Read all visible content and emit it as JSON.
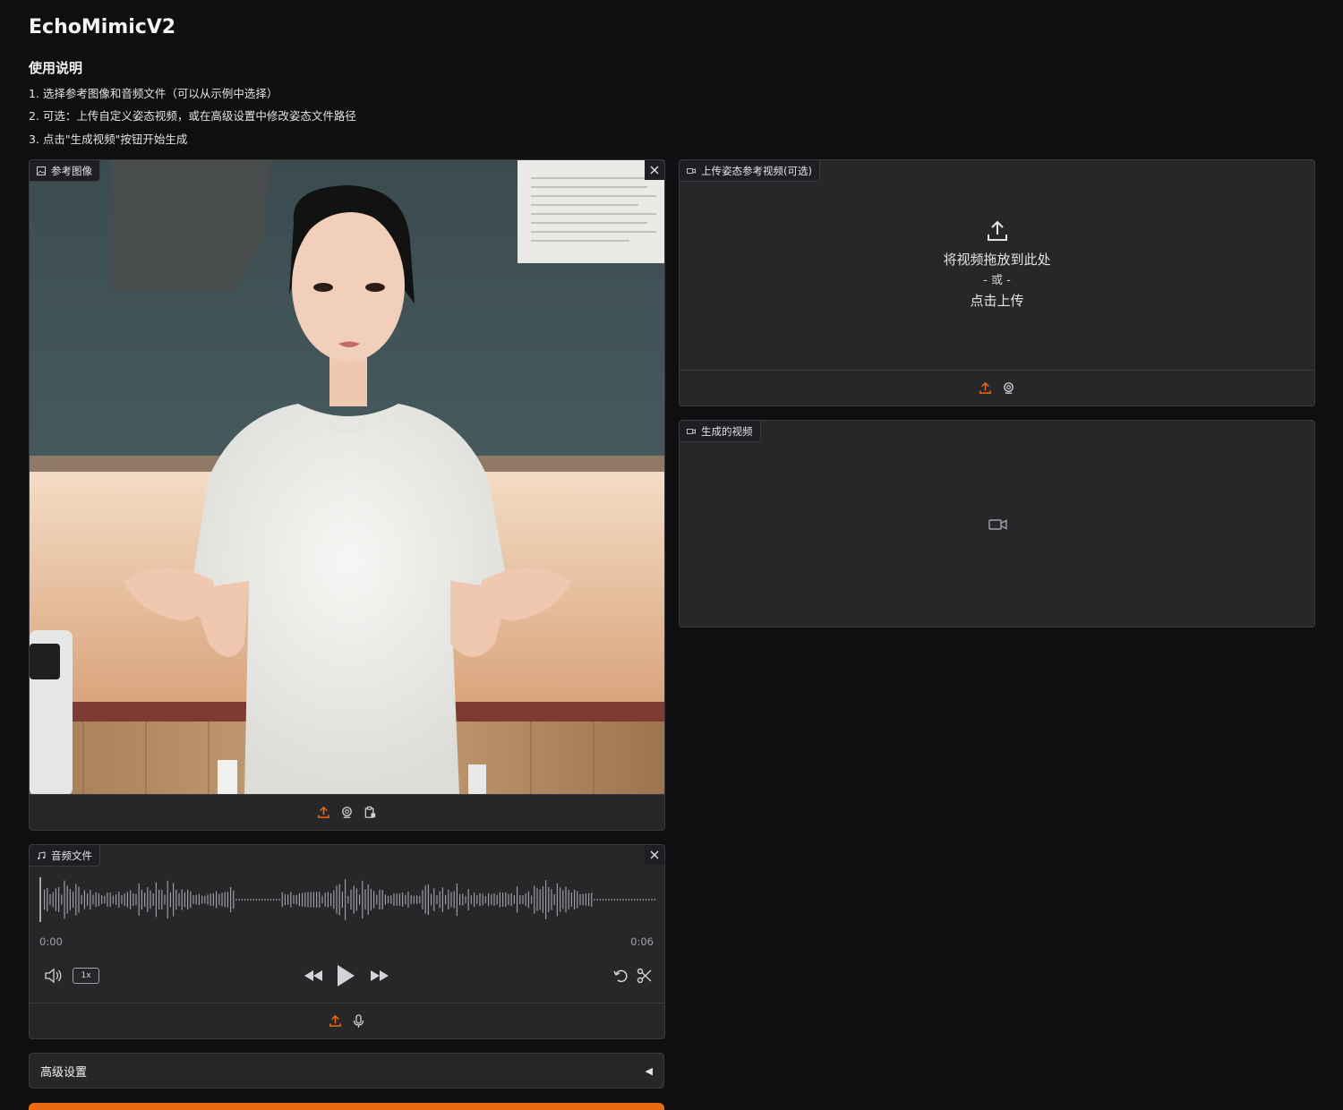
{
  "app": {
    "title": "EchoMimicV2"
  },
  "instructions": {
    "heading": "使用说明",
    "items": [
      "1. 选择参考图像和音频文件（可以从示例中选择）",
      "2. 可选：上传自定义姿态视频，或在高级设置中修改姿态文件路径",
      "3. 点击\"生成视频\"按钮开始生成"
    ]
  },
  "reference_image": {
    "label": "参考图像"
  },
  "pose_video": {
    "label": "上传姿态参考视频(可选)",
    "drop_text": "将视频拖放到此处",
    "or_text": "- 或 -",
    "click_text": "点击上传"
  },
  "output_video": {
    "label": "生成的视频"
  },
  "audio": {
    "label": "音频文件",
    "time_start": "0:00",
    "time_end": "0:06",
    "speed": "1x"
  },
  "advanced": {
    "label": "高级设置",
    "arrow": "◀"
  },
  "colors": {
    "accent": "#ea6a13",
    "panel": "#27272a",
    "background": "#0f0f11"
  },
  "icons": [
    "image-icon",
    "close-icon",
    "upload-icon",
    "webcam-icon",
    "clipboard-icon",
    "video-icon",
    "music-icon",
    "volume-icon",
    "rewind-icon",
    "play-icon",
    "fast-forward-icon",
    "undo-icon",
    "scissors-icon",
    "microphone-icon"
  ]
}
